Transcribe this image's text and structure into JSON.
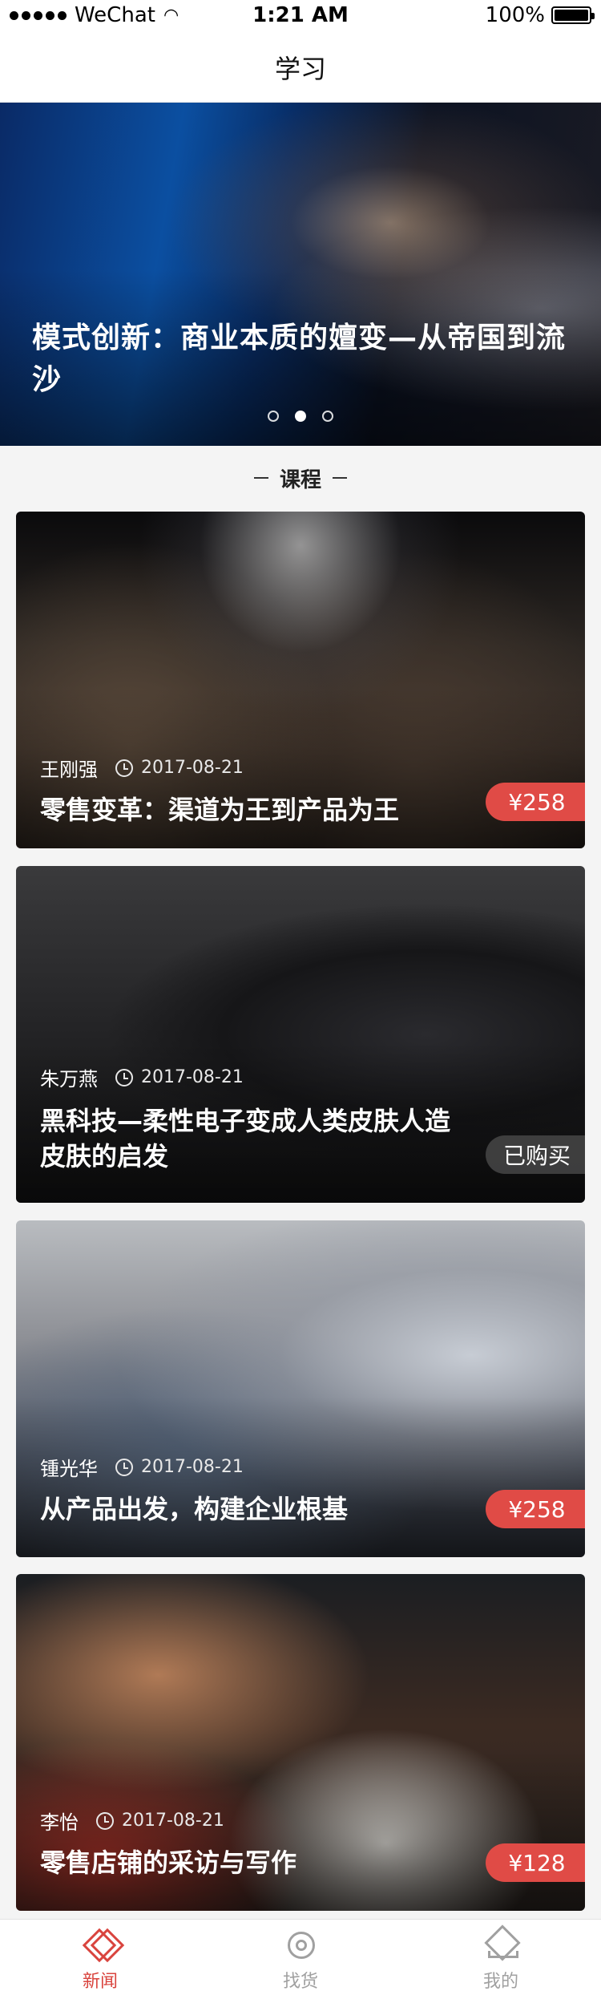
{
  "status_bar": {
    "carrier": "WeChat",
    "time": "1:21 AM",
    "battery": "100%",
    "battery_level": 1.0
  },
  "nav": {
    "title": "学习"
  },
  "banner": {
    "title": "模式创新：商业本质的嬗变—从帝国到流沙",
    "slide_count": 3,
    "active_slide": 2
  },
  "section": {
    "title": "课程"
  },
  "courses": [
    {
      "author": "王刚强",
      "date": "2017-08-21",
      "title": "零售变革：渠道为王到产品为王",
      "price": "¥258"
    },
    {
      "author": "朱万燕",
      "date": "2017-08-21",
      "title": "黑科技—柔性电子变成人类皮肤人造皮肤的启发",
      "price": "已购买"
    },
    {
      "author": "锺光华",
      "date": "2017-08-21",
      "title": "从产品出发，构建企业根基",
      "price": "¥258"
    },
    {
      "author": "李怡",
      "date": "2017-08-21",
      "title": "零售店铺的采访与写作",
      "price": "¥128"
    }
  ],
  "tab_bar": {
    "items": [
      {
        "label": "新闻",
        "icon": "news-icon",
        "active": true
      },
      {
        "label": "找货",
        "icon": "find-icon",
        "active": false
      },
      {
        "label": "我的",
        "icon": "me-icon",
        "active": false
      }
    ],
    "active_color": "#d9443e",
    "inactive_color": "#a0a0a0"
  },
  "colors": {
    "price_tag": "#e04b46",
    "bought_tag": "#464646"
  }
}
